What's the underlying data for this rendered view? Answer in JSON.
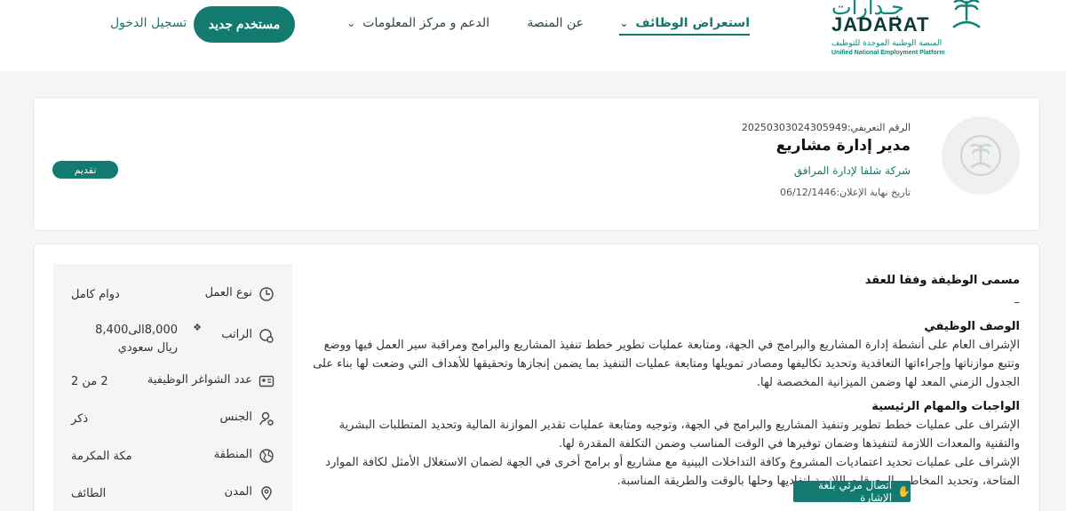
{
  "header": {
    "logo": {
      "ar": "جـدارات",
      "en": "JADARAT",
      "line1": "المنصة الوطنية الموحدة للتوظيف",
      "line2": "Unified National Employment Platform"
    },
    "nav": [
      {
        "label": "استعراض الوظائف",
        "has_dropdown": true,
        "active": true
      },
      {
        "label": "عن المنصة",
        "has_dropdown": false
      },
      {
        "label": "الدعم و مركز المعلومات",
        "has_dropdown": true
      }
    ],
    "new_user_label": "مستخدم جديد",
    "login_label": "تسجيل الدخول"
  },
  "job": {
    "ref": "الرقم التعريفي:20250303024305949",
    "title": "مدير إدارة مشاريع",
    "company": "شركة شلفا لإدارة المرافق",
    "deadline": "تاريخ نهاية الإعلان:06/12/1446",
    "apply_label": "تقديم"
  },
  "details": [
    {
      "label": "نوع العمل",
      "value": "دوام كامل",
      "icon": "clock-icon"
    },
    {
      "label": "الراتب",
      "value": "8,000الى8,400 ريال سعودي",
      "icon": "money-icon",
      "info": true
    },
    {
      "label": "عدد الشواغر الوظيفية",
      "value": "2 من 2",
      "icon": "id-card-icon"
    },
    {
      "label": "الجنس",
      "value": "ذكر",
      "icon": "gender-icon"
    },
    {
      "label": "المنطقة",
      "value": "مكة المكرمة",
      "icon": "map-icon"
    },
    {
      "label": "المدن",
      "value": "الطائف",
      "icon": "location-pin-icon"
    }
  ],
  "description": {
    "contract_title_label": "مسمى الوظيفة وفقا للعقد",
    "contract_title_value": "–",
    "job_desc_label": "الوصف الوظيفي",
    "job_desc_text": "الإشراف العام على أنشطة إدارة المشاريع والبرامج في الجهة، ومتابعة عمليات تطوير خطط تنفيذ المشاريع والبرامج ومراقبة سير العمل فيها ووضع وتتبع موازناتها وإجراءاتها التعاقدية وتحديد تكاليفها ومصادر تمويلها ومتابعة عمليات التنفيذ بما يضمن إنجازها وتحقيقها للأهداف التي وضعت لها بناء على الجدول الزمني المعد لها وضمن الميزانية المخصصة لها.",
    "duties_label": "الواجبات والمهام الرئيسية",
    "duty1": "الإشراف على عمليات خطط تطوير وتنفيذ المشاريع والبرامج في الجهة، وتوجيه ومتابعة عمليات تقدير الموازنة المالية وتحديد المتطلبات البشرية والتقنية والمعدات اللازمة لتنفيذها وضمان توفيرها في الوقت المناسب وضمن التكلفة المقدرة لها.",
    "duty2": "الإشراف على عمليات تحديد اعتماديات المشروع وكافة التداخلات البينية مع مشاريع أو برامج أخرى في الجهة لضمان الاستغلال الأمثل لكافة الموارد المتاحة، وتحديد المخاطر والمعوقات اللازمة لتفاديها وحلها بالوقت والطريقة المناسبة."
  },
  "sign_language_label": "اتصال مرئي بلغة الإشارة"
}
